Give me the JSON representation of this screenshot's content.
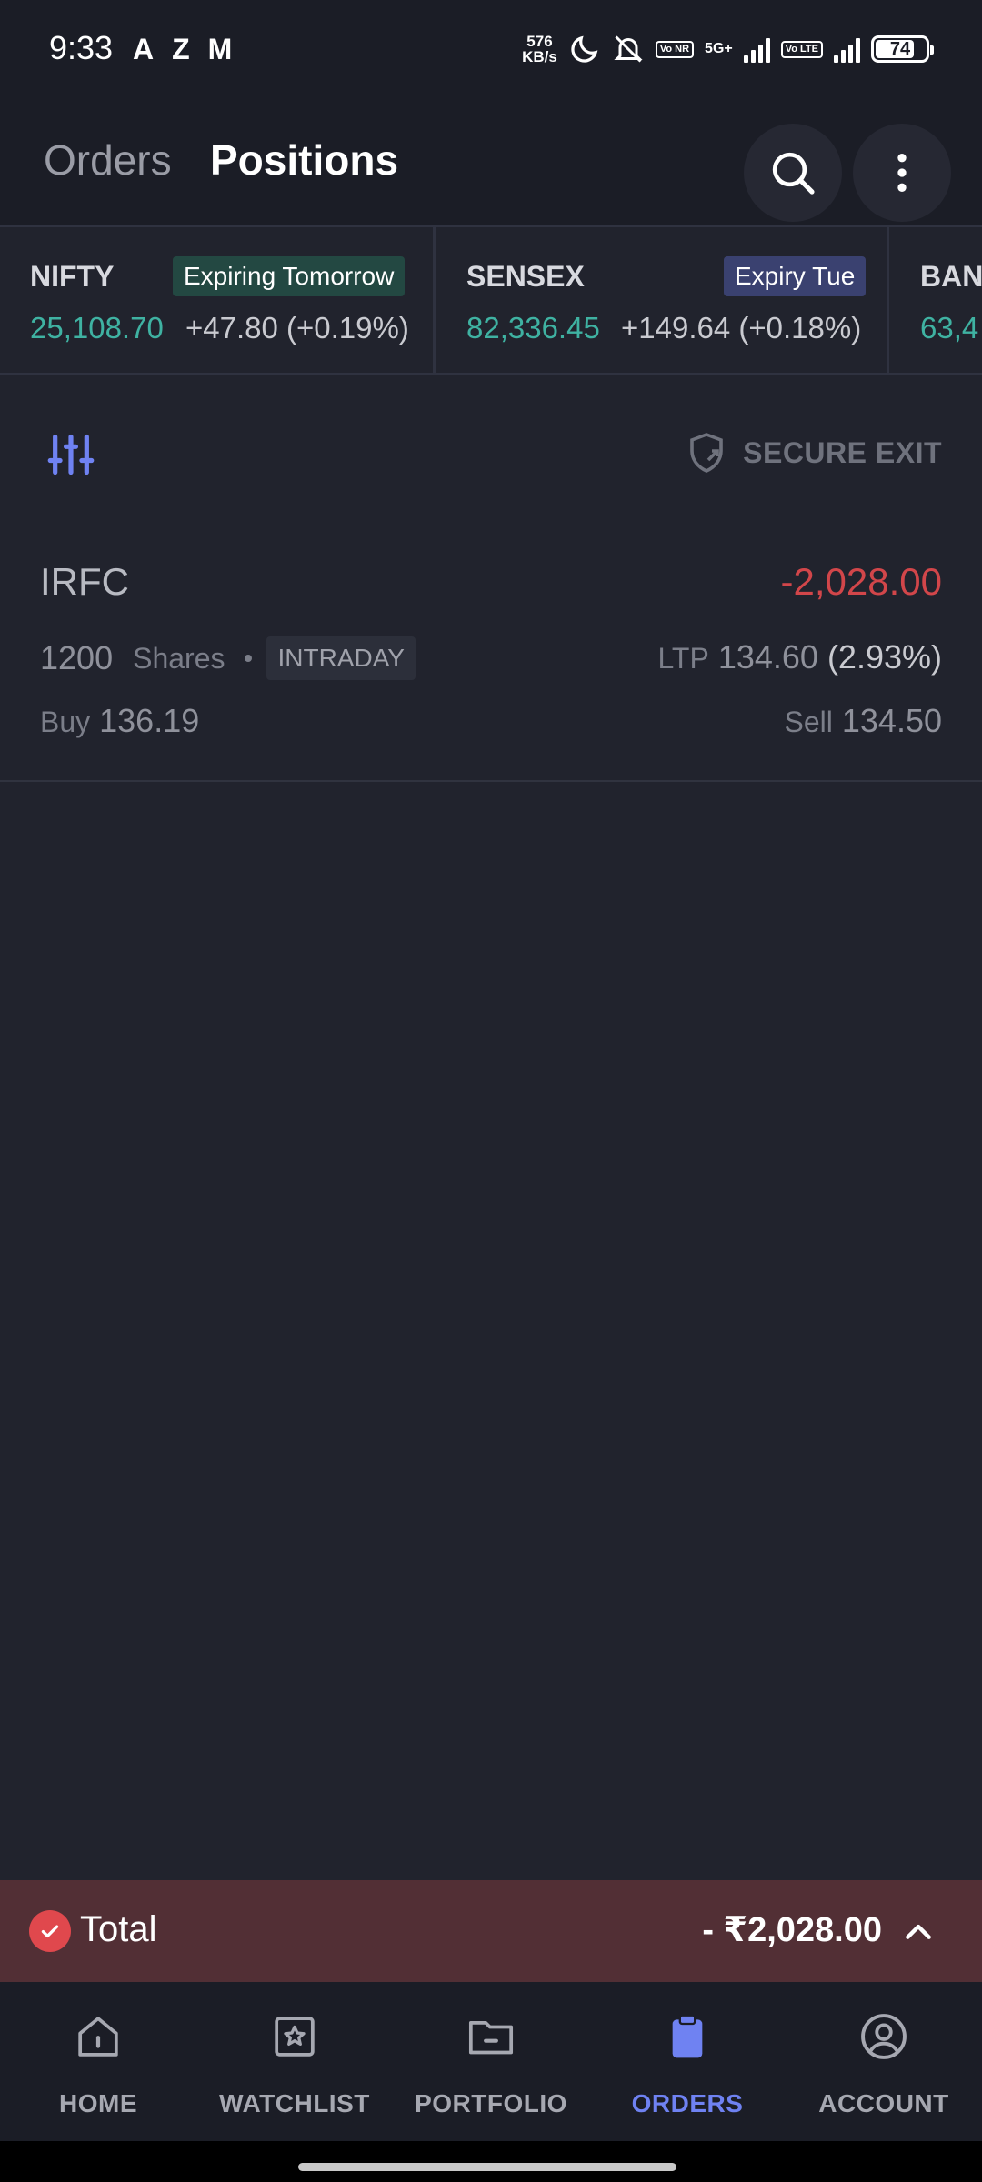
{
  "status_bar": {
    "time": "9:33",
    "notif_icons": [
      "A",
      "Z",
      "M"
    ],
    "speed": "576",
    "speed_unit": "KB/s",
    "vonr": "Vo NR",
    "network": "5G+",
    "volte": "Vo LTE",
    "battery": "74"
  },
  "header": {
    "tabs": [
      {
        "label": "Orders",
        "active": false
      },
      {
        "label": "Positions",
        "active": true
      }
    ]
  },
  "ticker": [
    {
      "name": "NIFTY",
      "badge": "Expiring Tomorrow",
      "price": "25,108.70",
      "change": "+47.80 (+0.19%)"
    },
    {
      "name": "SENSEX",
      "badge": "Expiry Tue",
      "price": "82,336.45",
      "change": "+149.64 (+0.18%)"
    },
    {
      "name": "BAN",
      "price": "63,4"
    }
  ],
  "toolbar": {
    "secure_exit_label": "SECURE EXIT"
  },
  "positions": [
    {
      "symbol": "IRFC",
      "pnl": "-2,028.00",
      "qty": "1200",
      "unit": "Shares",
      "product": "INTRADAY",
      "ltp_label": "LTP",
      "ltp": "134.60",
      "ltp_pct": "(2.93%)",
      "buy_label": "Buy",
      "buy": "136.19",
      "sell_label": "Sell",
      "sell": "134.50"
    }
  ],
  "total": {
    "label": "Total",
    "value": "- ₹2,028.00"
  },
  "bottom_nav": [
    {
      "label": "HOME",
      "active": false
    },
    {
      "label": "WATCHLIST",
      "active": false
    },
    {
      "label": "PORTFOLIO",
      "active": false
    },
    {
      "label": "ORDERS",
      "active": true
    },
    {
      "label": "ACCOUNT",
      "active": false
    }
  ],
  "colors": {
    "background": "#21232d",
    "header_bg": "#1b1d26",
    "gain": "#3fb2a2",
    "loss": "#d2464a",
    "accent": "#6f82f2",
    "total_bar": "#522f35"
  }
}
